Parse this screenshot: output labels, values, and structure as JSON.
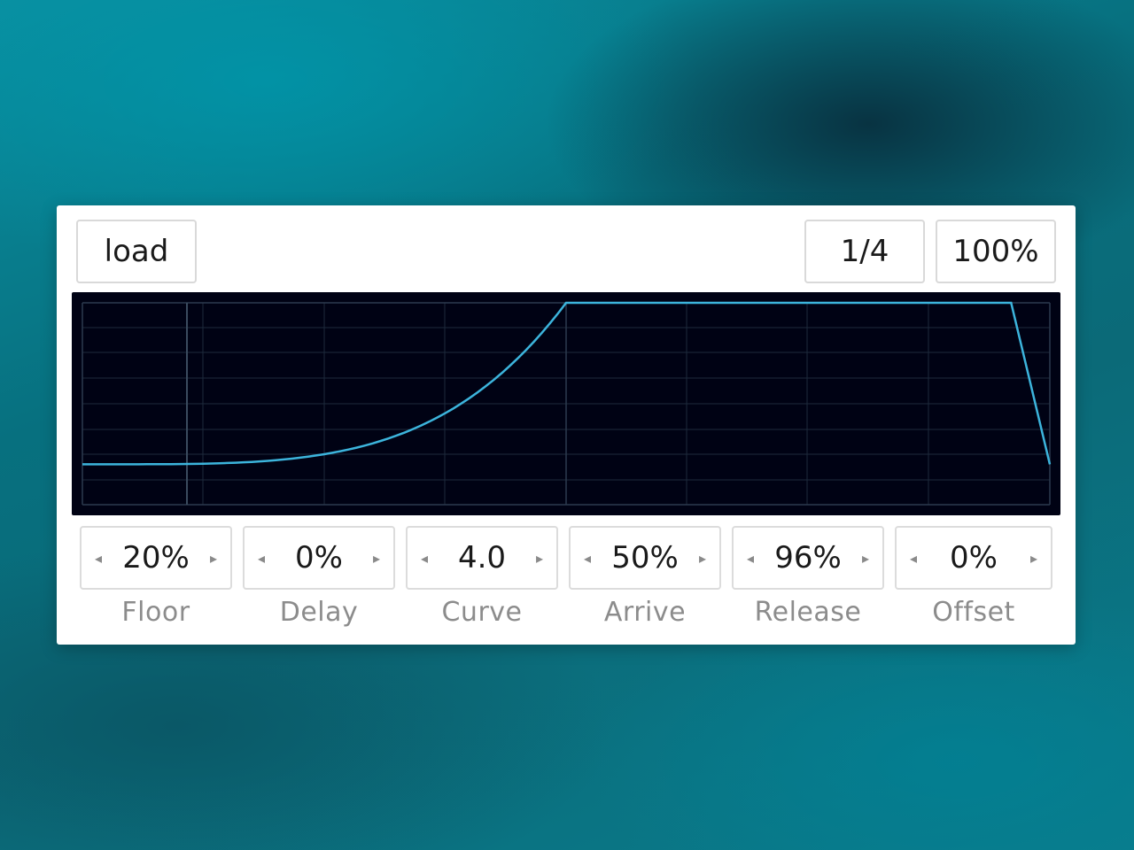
{
  "header": {
    "load_label": "load",
    "division": "1/4",
    "zoom": "100%"
  },
  "envelope": {
    "line_color": "#3cb4dc",
    "background_color": "#000214",
    "grid_color": "#1e2a3c"
  },
  "params": [
    {
      "name": "Floor",
      "value": "20%",
      "left_arrow": "◂",
      "right_arrow": "▸"
    },
    {
      "name": "Delay",
      "value": "0%",
      "left_arrow": "◂",
      "right_arrow": "▸"
    },
    {
      "name": "Curve",
      "value": "4.0",
      "left_arrow": "◂",
      "right_arrow": "▸"
    },
    {
      "name": "Arrive",
      "value": "50%",
      "left_arrow": "◂",
      "right_arrow": "▸"
    },
    {
      "name": "Release",
      "value": "96%",
      "left_arrow": "◂",
      "right_arrow": "▸"
    },
    {
      "name": "Offset",
      "value": "0%",
      "left_arrow": "◂",
      "right_arrow": "▸"
    }
  ]
}
